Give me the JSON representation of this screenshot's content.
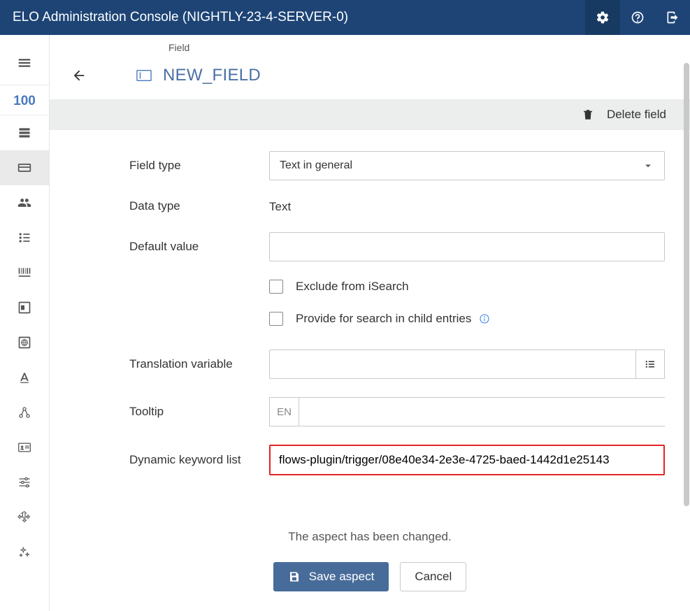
{
  "topbar": {
    "title": "ELO Administration Console (NIGHTLY-23-4-SERVER-0)"
  },
  "sidebar": {
    "number": "100"
  },
  "breadcrumb": {
    "label": "Field"
  },
  "page": {
    "title": "NEW_FIELD"
  },
  "actions": {
    "delete": "Delete field"
  },
  "form": {
    "field_type_label": "Field type",
    "field_type_value": "Text in general",
    "data_type_label": "Data type",
    "data_type_value": "Text",
    "default_value_label": "Default value",
    "default_value": "",
    "exclude_isearch_label": "Exclude from iSearch",
    "provide_child_label": "Provide for search in child entries",
    "translation_var_label": "Translation variable",
    "translation_var_value": "",
    "tooltip_label": "Tooltip",
    "tooltip_lang": "EN",
    "tooltip_value": "",
    "dynamic_keyword_label": "Dynamic keyword list",
    "dynamic_keyword_value": "flows-plugin/trigger/08e40e34-2e3e-4725-baed-1442d1e25143"
  },
  "footer": {
    "status": "The aspect has been changed.",
    "save_label": "Save aspect",
    "cancel_label": "Cancel"
  }
}
